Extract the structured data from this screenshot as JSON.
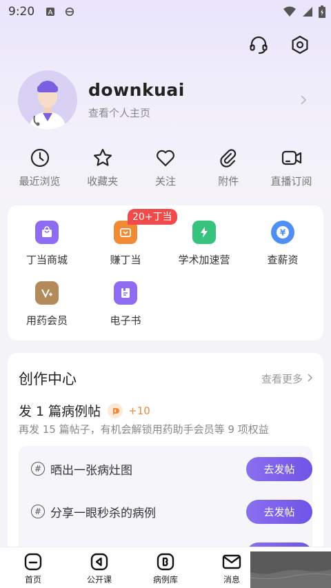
{
  "status_bar": {
    "time": "9:20",
    "icons": [
      "a-letter-icon",
      "ie-browser-icon"
    ],
    "right_icons": [
      "wifi-icon",
      "signal-icon",
      "battery-icon"
    ]
  },
  "header_actions": {
    "icons": [
      "headset-icon",
      "settings-icon"
    ]
  },
  "profile": {
    "username": "downkuai",
    "subtitle": "查看个人主页"
  },
  "quick_actions": [
    {
      "label": "最近浏览",
      "icon": "clock-icon"
    },
    {
      "label": "收藏夹",
      "icon": "star-icon"
    },
    {
      "label": "关注",
      "icon": "heart-icon"
    },
    {
      "label": "附件",
      "icon": "paperclip-icon"
    },
    {
      "label": "直播订阅",
      "icon": "video-camera-icon"
    }
  ],
  "services": [
    {
      "label": "丁当商城",
      "icon": "shop-bag-icon",
      "color": "#8e6cf2"
    },
    {
      "label": "赚丁当",
      "icon": "wallet-icon",
      "color": "#f18a35",
      "badge": "20+丁当"
    },
    {
      "label": "学术加速营",
      "icon": "lightning-icon",
      "color": "#37c27d"
    },
    {
      "label": "查薪资",
      "icon": "yuan-icon",
      "color": "#4e8ef5"
    },
    {
      "label": "用药会员",
      "icon": "v-plus-icon",
      "color": "#b38a5a"
    },
    {
      "label": "电子书",
      "icon": "ebook-icon",
      "color": "#8e6cf2"
    }
  ],
  "creation": {
    "title": "创作中心",
    "more": "查看更多",
    "task_title": "发 1 篇病例帖",
    "reward": "+10",
    "task_desc": "再发 15 篇帖子，有机会解锁用药助手会员等 9 项权益",
    "topics": [
      {
        "text": "晒出一张病灶图",
        "button": "去发帖"
      },
      {
        "text": "分享一眼秒杀的病例",
        "button": "去发帖"
      },
      {
        "text": "",
        "button": ""
      }
    ]
  },
  "tabbar": [
    {
      "label": "首页",
      "icon": "home-icon"
    },
    {
      "label": "公开课",
      "icon": "play-circle-icon"
    },
    {
      "label": "病例库",
      "icon": "case-library-icon"
    },
    {
      "label": "消息",
      "icon": "mail-icon"
    }
  ]
}
